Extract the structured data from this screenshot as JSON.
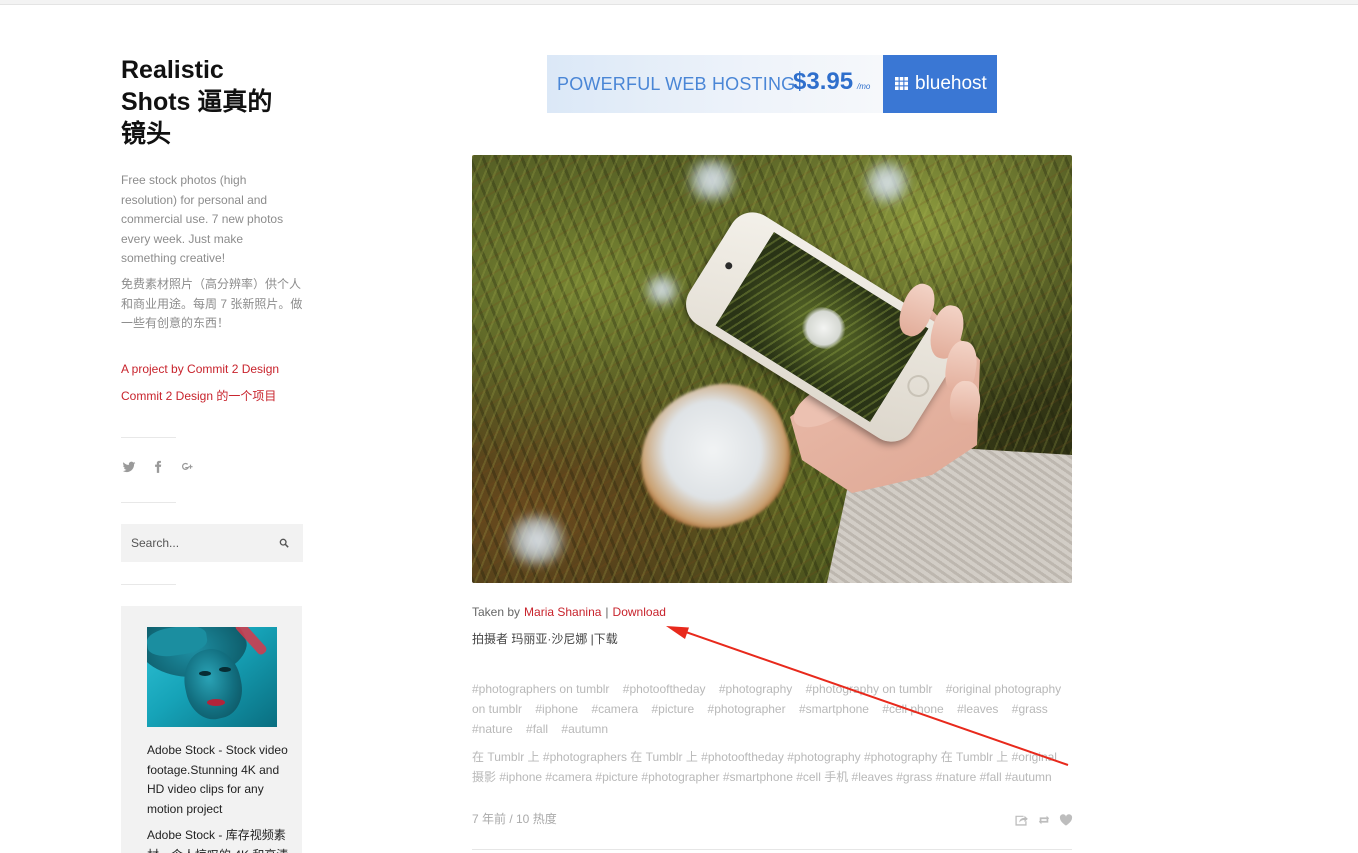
{
  "theme": {
    "accent": "#c8232c",
    "bluehost": "#3a77d4"
  },
  "sidebar": {
    "title": "Realistic Shots 逼真的镜头",
    "description_en": "Free stock photos (high resolution) for personal and commercial use. 7 new photos every week. Just make something creative!",
    "description_zh": "免费素材照片（高分辨率）供个人和商业用途。每周 7 张新照片。做一些有创意的东西！",
    "project_link_en": "A project by Commit 2 Design",
    "project_link_zh": "Commit 2 Design 的一个项目",
    "social_icons": [
      "twitter",
      "facebook",
      "google-plus"
    ],
    "search": {
      "placeholder": "Search...",
      "icon": "search"
    },
    "ad": {
      "text_en": "Adobe Stock - Stock video footage.Stunning 4K and HD video clips for any motion project",
      "text_zh": "Adobe Stock - 库存视频素材。令人惊叹的 4K 和高清"
    }
  },
  "banner": {
    "headline": "POWERFUL WEB HOSTING",
    "price": "$3.95",
    "price_unit": "/mo",
    "brand": "bluehost"
  },
  "post": {
    "caption": {
      "prefix": "Taken by",
      "author": "Maria Shanina",
      "separator": "|",
      "download": "Download"
    },
    "caption_zh": "拍摄者 玛丽亚·沙尼娜 |下载",
    "tags": [
      "#photographers on tumblr",
      "#photooftheday",
      "#photography",
      "#photography on tumblr",
      "#original photography on tumblr",
      "#iphone",
      "#camera",
      "#picture",
      "#photographer",
      "#smartphone",
      "#cell phone",
      "#leaves",
      "#grass",
      "#nature",
      "#fall",
      "#autumn"
    ],
    "tags_zh": "在 Tumblr 上 #photographers 在 Tumblr 上 #photooftheday #photography #photography 在 Tumblr 上 #original 摄影 #iphone #camera #picture #photographer #smartphone #cell 手机 #leaves #grass #nature #fall #autumn",
    "meta": "7 年前 / 10 热度",
    "actions": [
      "share",
      "reblog",
      "like"
    ]
  }
}
